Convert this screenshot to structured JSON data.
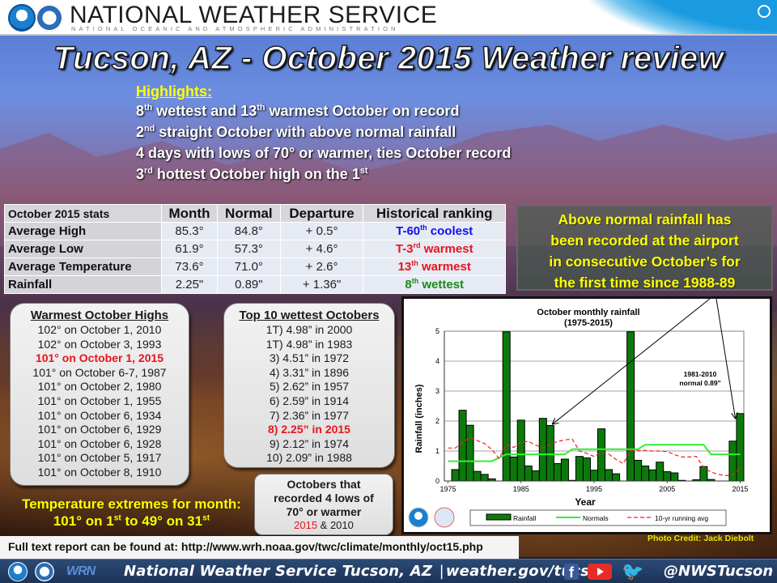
{
  "header": {
    "title": "NATIONAL WEATHER SERVICE",
    "subtitle": "NATIONAL OCEANIC AND ATMOSPHERIC ADMINISTRATION",
    "logos": [
      "noaa-logo",
      "nws-logo",
      "doc-seal"
    ]
  },
  "title": "Tucson, AZ  - October 2015 Weather review",
  "highlights": {
    "heading": "Highlights:",
    "items": [
      {
        "pre": "8",
        "sup1": "th",
        "mid": " wettest and 13",
        "sup2": "th",
        "post": " warmest October on record"
      },
      {
        "pre": "2",
        "sup1": "nd",
        "mid": " straight October with  above normal rainfall",
        "sup2": "",
        "post": ""
      },
      {
        "pre": "4 days with  lows  of 70° or warmer, ties October record",
        "sup1": "",
        "mid": "",
        "sup2": "",
        "post": ""
      },
      {
        "pre": "3",
        "sup1": "rd",
        "mid": " hottest October high on the 1",
        "sup2": "st",
        "post": ""
      }
    ]
  },
  "stats_table": {
    "headers": [
      "October 2015 stats",
      "Month",
      "Normal",
      "Departure",
      "Historical ranking"
    ],
    "rows": [
      {
        "label": "Average High",
        "month": "85.3°",
        "normal": "84.8°",
        "departure": "+ 0.5°",
        "rank_pre": "T-60",
        "rank_sup": "th",
        "rank_post": " coolest",
        "rank_color": "#1010e8"
      },
      {
        "label": "Average Low",
        "month": "61.9°",
        "normal": "57.3°",
        "departure": "+ 4.6°",
        "rank_pre": "T-3",
        "rank_sup": "rd",
        "rank_post": " warmest",
        "rank_color": "#e8141c"
      },
      {
        "label": "Average  Temperature",
        "month": "73.6°",
        "normal": "71.0°",
        "departure": "+ 2.6°",
        "rank_pre": "13",
        "rank_sup": "th",
        "rank_post": " warmest",
        "rank_color": "#e8141c"
      },
      {
        "label": "Rainfall",
        "month": "2.25\"",
        "normal": "0.89\"",
        "departure": "+ 1.36\"",
        "rank_pre": "8",
        "rank_sup": "th",
        "rank_post": " wettest",
        "rank_color": "#1a8a1a"
      }
    ]
  },
  "rain_note": {
    "lines": [
      "Above normal rainfall has",
      "been recorded at the airport",
      "in consecutive October’s for",
      "the first time since 1988-89"
    ]
  },
  "warmest_highs": {
    "title": "Warmest October Highs",
    "items": [
      {
        "text": "102° on October 1, 2010",
        "highlight": false
      },
      {
        "text": "102° on October 3, 1993",
        "highlight": false
      },
      {
        "text": "101° on October 1, 2015",
        "highlight": true
      },
      {
        "text": "101° on October 6-7, 1987",
        "highlight": false
      },
      {
        "text": "101° on October 2, 1980",
        "highlight": false
      },
      {
        "text": "101° on October 1, 1955",
        "highlight": false
      },
      {
        "text": "101° on October 6, 1934",
        "highlight": false
      },
      {
        "text": "101° on October 6, 1929",
        "highlight": false
      },
      {
        "text": "101° on October 6, 1928",
        "highlight": false
      },
      {
        "text": "101° on October 5, 1917",
        "highlight": false
      },
      {
        "text": "101° on October 8, 1910",
        "highlight": false
      }
    ]
  },
  "wettest": {
    "title": "Top 10 wettest Octobers",
    "items": [
      {
        "text": "1T) 4.98” in 2000",
        "highlight": false
      },
      {
        "text": "1T) 4.98” in 1983",
        "highlight": false
      },
      {
        "text": "3) 4.51” in 1972",
        "highlight": false
      },
      {
        "text": "4) 3.31” in 1896",
        "highlight": false
      },
      {
        "text": "5) 2.62” in 1957",
        "highlight": false
      },
      {
        "text": "6) 2.59” in 1914",
        "highlight": false
      },
      {
        "text": "7) 2.36” in 1977",
        "highlight": false
      },
      {
        "text": "8) 2.25” in 2015",
        "highlight": true
      },
      {
        "text": "9) 2.12” in 1974",
        "highlight": false
      },
      {
        "text": "10) 2.09” in 1988",
        "highlight": false
      }
    ]
  },
  "warm_lows": {
    "lines": [
      "Octobers that",
      "recorded 4 lows of",
      "70° or warmer"
    ],
    "year_red": "2015",
    "year_rest": " & 2010"
  },
  "extremes": {
    "line1": "Temperature extremes for month:",
    "l2_a": "101° on 1",
    "l2_sup1": "st",
    "l2_b": " to 49° on 31",
    "l2_sup2": "st"
  },
  "chart_data": {
    "type": "bar",
    "title": "October monthly rainfall",
    "subtitle": "(1975-2015)",
    "xlabel": "Year",
    "ylabel": "Rainfall (inches)",
    "ylim": [
      0,
      5
    ],
    "xlim": [
      1975,
      2015
    ],
    "yticks": [
      0,
      1,
      2,
      3,
      4,
      5
    ],
    "xticks": [
      1975,
      1985,
      1995,
      2005,
      2015
    ],
    "grid": true,
    "annotation": [
      "1981-2010",
      "normal 0.89\""
    ],
    "legend": {
      "position": "bottom",
      "entries": [
        "Rainfall",
        "Normals",
        "10-yr running avg"
      ]
    },
    "series": [
      {
        "name": "Rainfall",
        "type": "bar",
        "color": "#0b7a0b",
        "x": [
          1975,
          1976,
          1977,
          1978,
          1979,
          1980,
          1981,
          1982,
          1983,
          1984,
          1985,
          1986,
          1987,
          1988,
          1989,
          1990,
          1991,
          1992,
          1993,
          1994,
          1995,
          1996,
          1997,
          1998,
          1999,
          2000,
          2001,
          2002,
          2003,
          2004,
          2005,
          2006,
          2007,
          2008,
          2009,
          2010,
          2011,
          2012,
          2013,
          2014,
          2015
        ],
        "values": [
          0.0,
          0.38,
          2.36,
          1.86,
          0.32,
          0.22,
          0.07,
          0.0,
          4.98,
          0.8,
          2.03,
          0.5,
          0.34,
          2.09,
          1.85,
          0.58,
          0.73,
          0.02,
          0.82,
          0.77,
          0.36,
          1.74,
          0.38,
          0.24,
          0.0,
          4.98,
          0.69,
          0.5,
          0.37,
          0.63,
          0.31,
          0.27,
          0.02,
          0.0,
          0.04,
          0.48,
          0.05,
          0.0,
          0.0,
          1.33,
          2.25
        ]
      },
      {
        "name": "Normals",
        "type": "line",
        "color": "#33ee33",
        "x": [
          1975,
          1981,
          1982,
          1983,
          1991,
          1992,
          2001,
          2002,
          2010,
          2011,
          2015
        ],
        "values": [
          0.66,
          0.66,
          0.78,
          0.89,
          0.89,
          1.06,
          1.06,
          1.21,
          1.21,
          0.89,
          0.89
        ]
      },
      {
        "name": "10-yr running avg",
        "type": "line",
        "dashed": true,
        "color": "#ee2222",
        "x": [
          1975,
          1976,
          1977,
          1978,
          1979,
          1980,
          1981,
          1982,
          1983,
          1984,
          1985,
          1986,
          1987,
          1988,
          1989,
          1990,
          1991,
          1992,
          1993,
          1994,
          1995,
          1996,
          1997,
          1998,
          1999,
          2000,
          2001,
          2002,
          2003,
          2004,
          2005,
          2006,
          2007,
          2008,
          2009,
          2010,
          2011,
          2012,
          2013,
          2014,
          2015
        ],
        "values": [
          1.1,
          1.1,
          1.28,
          1.45,
          1.35,
          1.25,
          1.05,
          0.75,
          1.22,
          1.12,
          1.3,
          1.32,
          1.2,
          1.1,
          1.22,
          1.32,
          1.37,
          1.4,
          1.0,
          0.92,
          0.82,
          0.95,
          0.9,
          0.72,
          0.58,
          1.02,
          1.02,
          1.02,
          1.0,
          1.0,
          0.98,
          0.88,
          0.8,
          0.8,
          0.82,
          0.45,
          0.3,
          0.22,
          0.18,
          0.2,
          0.45
        ]
      }
    ],
    "arrows_target_years": [
      1989,
      2015
    ]
  },
  "photo_credit": "Photo Credit: Jack Diebolt",
  "report": {
    "text": "Full text report can be found at: http://www.wrh.noaa.gov/twc/climate/monthly/oct15.php"
  },
  "footer": {
    "org": "National Weather Service Tucson, AZ",
    "separator": "|",
    "site": "weather.gov/tucson",
    "wrn": "WRN",
    "handle": "@NWSTucson",
    "social": [
      "facebook",
      "youtube",
      "twitter"
    ]
  }
}
